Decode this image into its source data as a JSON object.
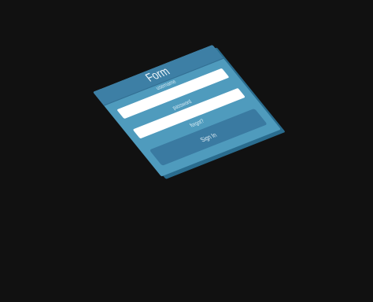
{
  "form": {
    "title": "Form",
    "username_placeholder": "username",
    "password_placeholder": "password",
    "forgot_label": "forgot?",
    "signin_label": "Sign In"
  },
  "colors": {
    "background": "#111111",
    "card": "#4f9bbd",
    "card_header": "#3d7fa5",
    "card_side": "#2a6c8e",
    "button": "#3a7aa1",
    "input": "#ffffff"
  }
}
